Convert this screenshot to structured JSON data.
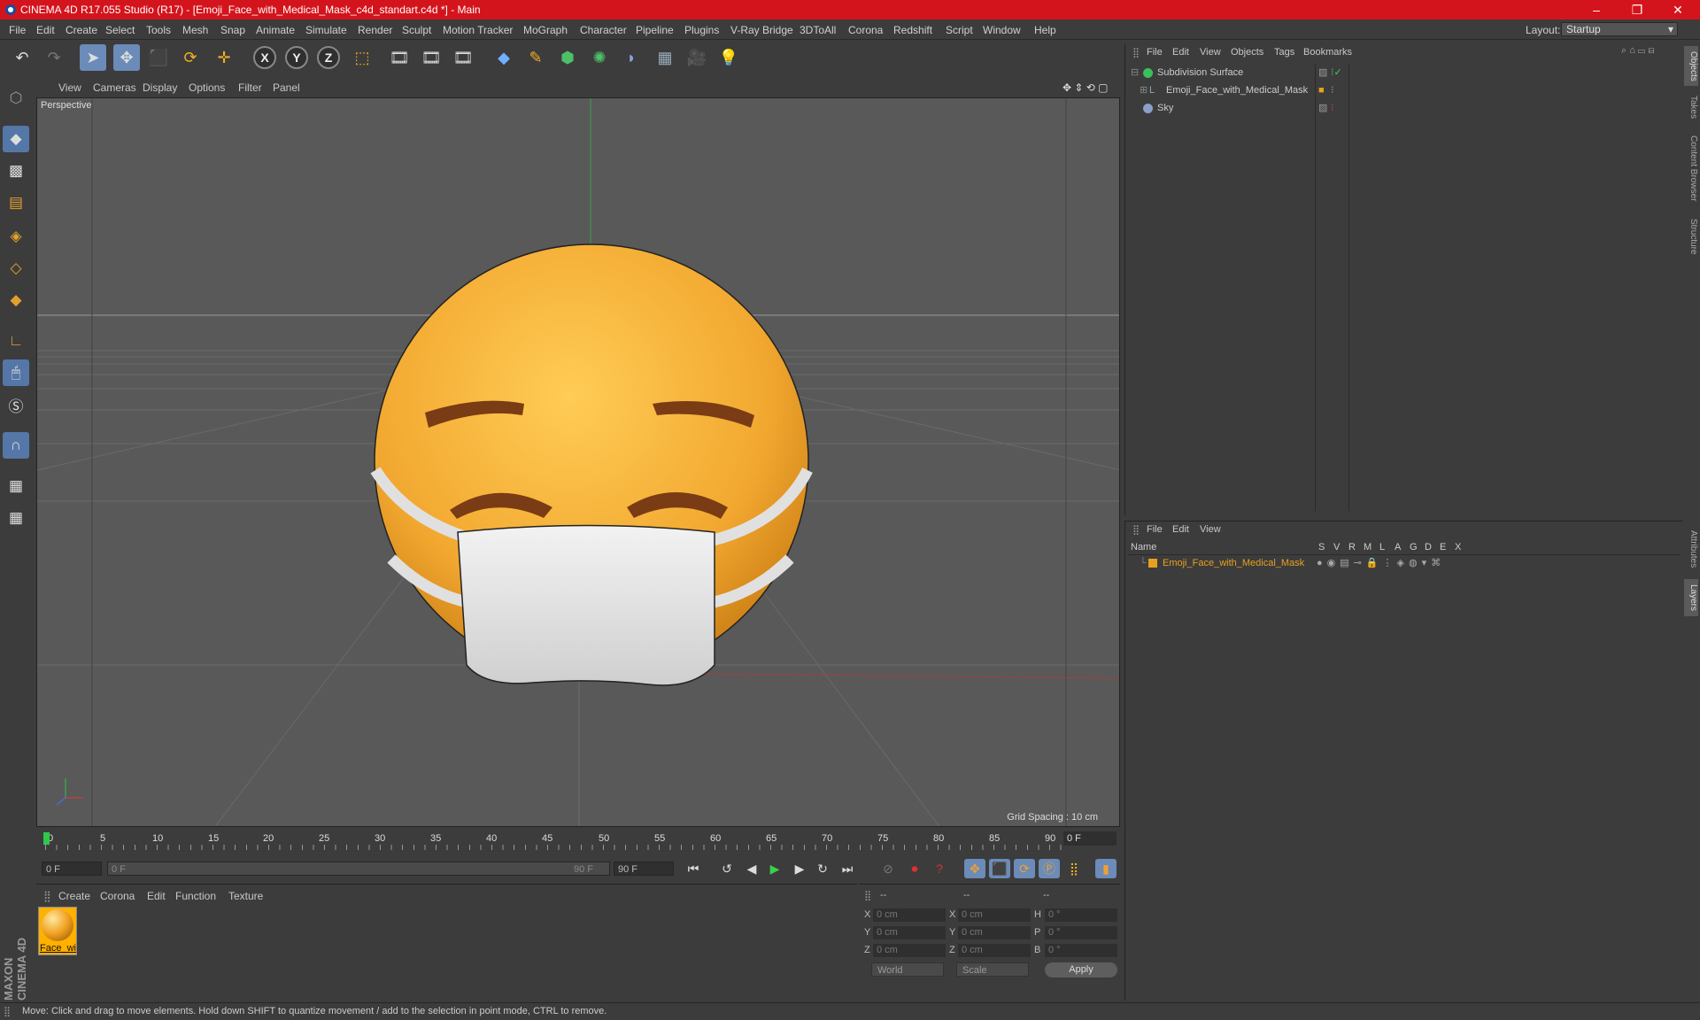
{
  "window": {
    "title": "CINEMA 4D R17.055 Studio (R17) - [Emoji_Face_with_Medical_Mask_c4d_standart.c4d *] - Main",
    "minimize": "–",
    "maximize": "❐",
    "close": "✕"
  },
  "menubar": {
    "items": [
      "File",
      "Edit",
      "Create",
      "Select",
      "Tools",
      "Mesh",
      "Snap",
      "Animate",
      "Simulate",
      "Render",
      "Sculpt",
      "Motion Tracker",
      "MoGraph",
      "Character",
      "Pipeline",
      "Plugins",
      "V-Ray Bridge",
      "3DToAll",
      "Corona",
      "Redshift",
      "Script",
      "Window",
      "Help"
    ],
    "layout_label": "Layout:",
    "layout_value": "Startup"
  },
  "toolbar": {
    "axis_x": "X",
    "axis_y": "Y",
    "axis_z": "Z"
  },
  "viewport": {
    "menu": [
      "View",
      "Cameras",
      "Display",
      "Options",
      "Filter",
      "Panel"
    ],
    "camera_label": "Perspective",
    "grid_spacing": "Grid Spacing : 10 cm"
  },
  "timeline": {
    "ticks": [
      "0",
      "5",
      "10",
      "15",
      "20",
      "25",
      "30",
      "35",
      "40",
      "45",
      "50",
      "55",
      "60",
      "65",
      "70",
      "75",
      "80",
      "85",
      "90"
    ],
    "current_frame_field": "0 F",
    "start_field": "0 F",
    "range_start": "0 F",
    "range_end": "90 F",
    "end_field": "90 F"
  },
  "material_manager": {
    "menu": [
      "Create",
      "Corona",
      "Edit",
      "Function",
      "Texture"
    ],
    "material_name": "Face_wi"
  },
  "coordinates": {
    "header_dashes": [
      "--",
      "--",
      "--"
    ],
    "rows": [
      {
        "a_label": "X",
        "a_val": "0 cm",
        "b_label": "X",
        "b_val": "0 cm",
        "c_label": "H",
        "c_val": "0 °"
      },
      {
        "a_label": "Y",
        "a_val": "0 cm",
        "b_label": "Y",
        "b_val": "0 cm",
        "c_label": "P",
        "c_val": "0 °"
      },
      {
        "a_label": "Z",
        "a_val": "0 cm",
        "b_label": "Z",
        "b_val": "0 cm",
        "c_label": "B",
        "c_val": "0 °"
      }
    ],
    "mode_world": "World",
    "mode_scale": "Scale",
    "apply": "Apply"
  },
  "object_manager": {
    "menu": [
      "File",
      "Edit",
      "View",
      "Objects",
      "Tags",
      "Bookmarks"
    ],
    "objects": [
      "Subdivision Surface",
      "Emoji_Face_with_Medical_Mask",
      "Sky"
    ]
  },
  "layer_manager": {
    "menu": [
      "File",
      "Edit",
      "View"
    ],
    "columns": [
      "Name",
      "S",
      "V",
      "R",
      "M",
      "L",
      "A",
      "G",
      "D",
      "E",
      "X"
    ],
    "layer_name": "Emoji_Face_with_Medical_Mask"
  },
  "right_tabs": [
    "Objects",
    "Takes",
    "Content Browser",
    "Structure",
    "Attributes",
    "Layers"
  ],
  "status": "Move: Click and drag to move elements. Hold down SHIFT to quantize movement / add to the selection in point mode, CTRL to remove.",
  "branding": "MAXON CINEMA 4D",
  "colors": {
    "title_bar": "#d4141c",
    "accent": "#6b8bb8",
    "emoji": "#f7b42c",
    "layer": "#e8a020"
  }
}
